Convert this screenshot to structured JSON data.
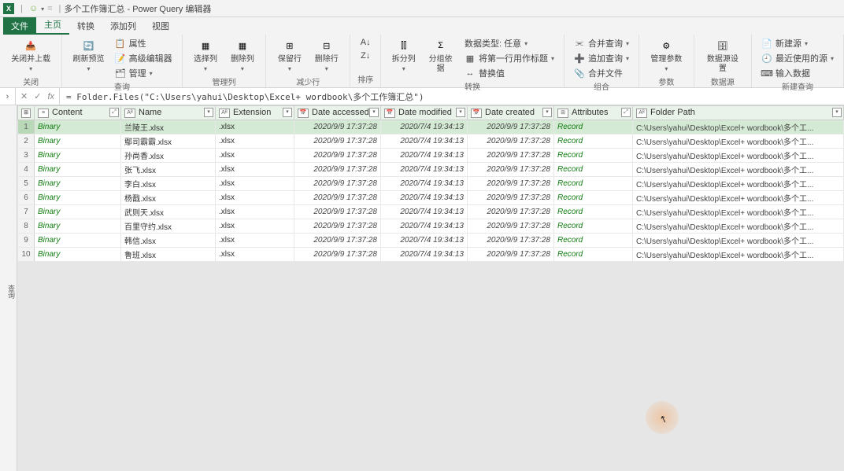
{
  "title": {
    "doc": "多个工作簿汇总",
    "app": "Power Query 编辑器"
  },
  "tabs": {
    "file": "文件",
    "home": "主页",
    "transform": "转换",
    "addcol": "添加列",
    "view": "视图"
  },
  "ribbon": {
    "close_group": "关闭",
    "close_load": "关闭并上载",
    "query_group": "查询",
    "refresh": "刷新预览",
    "properties": "属性",
    "adv_editor": "高级编辑器",
    "manage": "管理",
    "manage_cols_group": "管理列",
    "choose_cols": "选择列",
    "remove_cols": "删除列",
    "reduce_rows_group": "减少行",
    "keep_rows": "保留行",
    "remove_rows": "删除行",
    "sort_group": "排序",
    "transform_group": "转换",
    "split_col": "拆分列",
    "group_by": "分组依据",
    "data_type": "数据类型: 任意",
    "first_row_header": "将第一行用作标题",
    "replace_values": "替换值",
    "combine_group": "组合",
    "merge_queries": "合并查询",
    "append_queries": "追加查询",
    "combine_files": "合并文件",
    "params_group": "参数",
    "manage_params": "管理参数",
    "data_sources_group": "数据源",
    "data_source_settings": "数据源设置",
    "new_query_group": "新建查询",
    "new_source": "新建源",
    "recent_sources": "最近使用的源",
    "enter_data": "输入数据"
  },
  "formula": "= Folder.Files(\"C:\\Users\\yahui\\Desktop\\Excel+ wordbook\\多个工作簿汇总\")",
  "columns": {
    "content": "Content",
    "name": "Name",
    "extension": "Extension",
    "date_accessed": "Date accessed",
    "date_modified": "Date modified",
    "date_created": "Date created",
    "attributes": "Attributes",
    "folder_path": "Folder Path"
  },
  "cell_values": {
    "binary": "Binary",
    "ext": ".xlsx",
    "record": "Record"
  },
  "rows": [
    {
      "name": "兰陵王.xlsx",
      "accessed": "2020/9/9 17:37:28",
      "modified": "2020/7/4 19:34:13",
      "created": "2020/9/9 17:37:28",
      "path": "C:\\Users\\yahui\\Desktop\\Excel+ wordbook\\多个工..."
    },
    {
      "name": "鄢司霸霸.xlsx",
      "accessed": "2020/9/9 17:37:28",
      "modified": "2020/7/4 19:34:13",
      "created": "2020/9/9 17:37:28",
      "path": "C:\\Users\\yahui\\Desktop\\Excel+ wordbook\\多个工..."
    },
    {
      "name": "孙尚香.xlsx",
      "accessed": "2020/9/9 17:37:28",
      "modified": "2020/7/4 19:34:13",
      "created": "2020/9/9 17:37:28",
      "path": "C:\\Users\\yahui\\Desktop\\Excel+ wordbook\\多个工..."
    },
    {
      "name": "张飞.xlsx",
      "accessed": "2020/9/9 17:37:28",
      "modified": "2020/7/4 19:34:13",
      "created": "2020/9/9 17:37:28",
      "path": "C:\\Users\\yahui\\Desktop\\Excel+ wordbook\\多个工..."
    },
    {
      "name": "李白.xlsx",
      "accessed": "2020/9/9 17:37:28",
      "modified": "2020/7/4 19:34:13",
      "created": "2020/9/9 17:37:28",
      "path": "C:\\Users\\yahui\\Desktop\\Excel+ wordbook\\多个工..."
    },
    {
      "name": "杨戬.xlsx",
      "accessed": "2020/9/9 17:37:28",
      "modified": "2020/7/4 19:34:13",
      "created": "2020/9/9 17:37:28",
      "path": "C:\\Users\\yahui\\Desktop\\Excel+ wordbook\\多个工..."
    },
    {
      "name": "武则天.xlsx",
      "accessed": "2020/9/9 17:37:28",
      "modified": "2020/7/4 19:34:13",
      "created": "2020/9/9 17:37:28",
      "path": "C:\\Users\\yahui\\Desktop\\Excel+ wordbook\\多个工..."
    },
    {
      "name": "百里守约.xlsx",
      "accessed": "2020/9/9 17:37:28",
      "modified": "2020/7/4 19:34:13",
      "created": "2020/9/9 17:37:28",
      "path": "C:\\Users\\yahui\\Desktop\\Excel+ wordbook\\多个工..."
    },
    {
      "name": "韩信.xlsx",
      "accessed": "2020/9/9 17:37:28",
      "modified": "2020/7/4 19:34:13",
      "created": "2020/9/9 17:37:28",
      "path": "C:\\Users\\yahui\\Desktop\\Excel+ wordbook\\多个工..."
    },
    {
      "name": "鲁班.xlsx",
      "accessed": "2020/9/9 17:37:28",
      "modified": "2020/7/4 19:34:13",
      "created": "2020/9/9 17:37:28",
      "path": "C:\\Users\\yahui\\Desktop\\Excel+ wordbook\\多个工..."
    }
  ],
  "side_label": "查询"
}
